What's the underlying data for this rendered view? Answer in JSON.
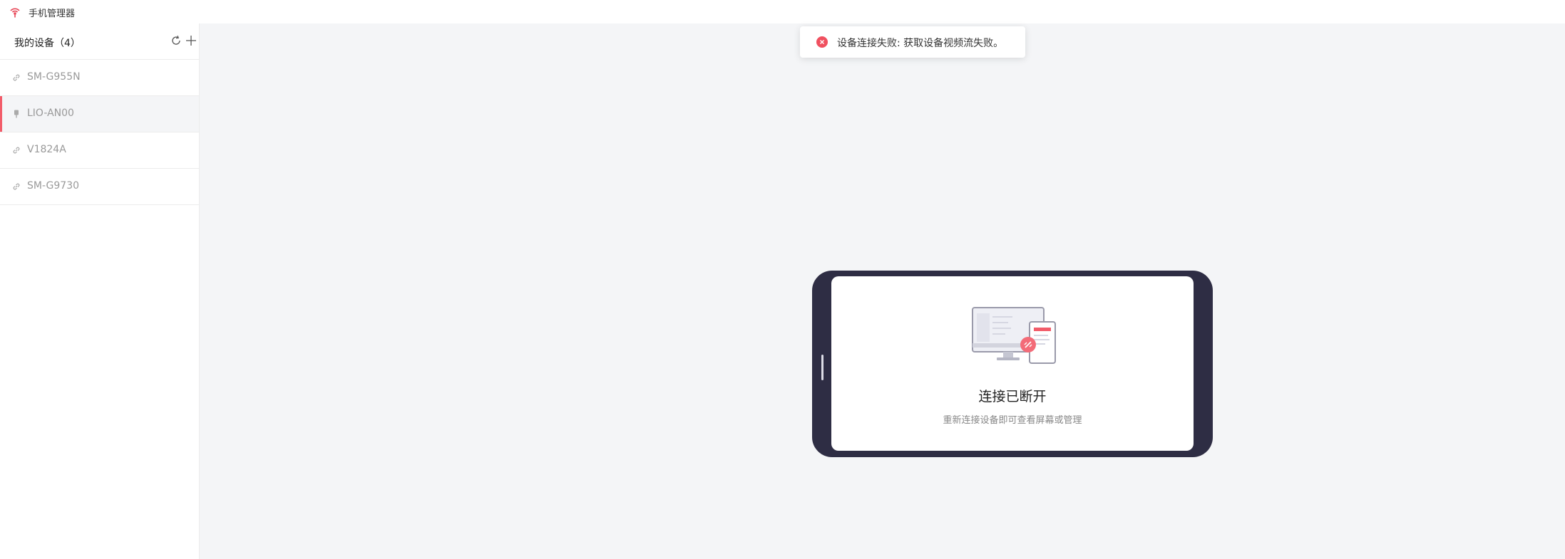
{
  "app": {
    "title": "手机管理器"
  },
  "sidebar": {
    "title": "我的设备（4）",
    "refresh_icon": "refresh-icon",
    "add_icon": "plus-icon",
    "devices": [
      {
        "label": "SM-G955N",
        "icon": "link-icon",
        "active": false
      },
      {
        "label": "LIO-AN00",
        "icon": "usb-icon",
        "active": true
      },
      {
        "label": "V1824A",
        "icon": "link-icon",
        "active": false
      },
      {
        "label": "SM-G9730",
        "icon": "link-icon",
        "active": false
      }
    ]
  },
  "toast": {
    "icon": "error-icon",
    "message": "设备连接失败: 获取设备视频流失败。"
  },
  "phone": {
    "title": "连接已断开",
    "subtitle": "重新连接设备即可查看屏幕或管理"
  },
  "colors": {
    "accent": "#f25c6a",
    "phone_frame": "#2e2d44",
    "main_bg": "#f4f5f7"
  }
}
